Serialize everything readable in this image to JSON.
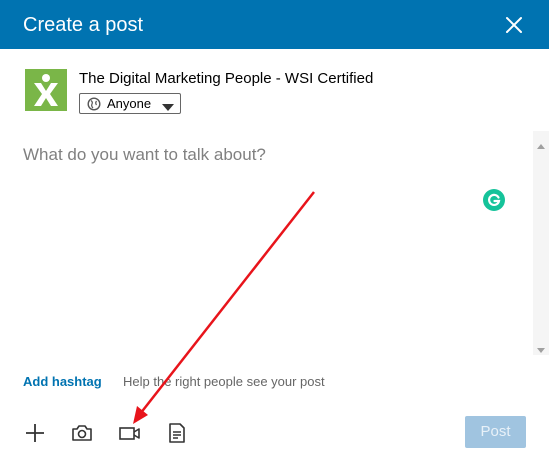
{
  "header": {
    "title": "Create a post",
    "close_icon": "close-icon"
  },
  "author": {
    "name": "The Digital Marketing People - WSI Certified",
    "logo_icon": "wsi-logo",
    "visibility": {
      "label": "Anyone",
      "icon": "globe-icon"
    }
  },
  "editor": {
    "placeholder": "What do you want to talk about?",
    "value": ""
  },
  "hashtag": {
    "link_label": "Add hashtag",
    "help_text": "Help the right people see your post"
  },
  "toolbar": {
    "icons": [
      "plus-icon",
      "camera-icon",
      "video-icon",
      "document-icon"
    ],
    "post_label": "Post"
  },
  "colors": {
    "header_bg": "#0073b1",
    "link": "#0073b1",
    "post_button_disabled": "#a0c4e0",
    "logo_green": "#7ab648",
    "grammarly": "#15c39a",
    "annotation_arrow": "#e8141b"
  }
}
